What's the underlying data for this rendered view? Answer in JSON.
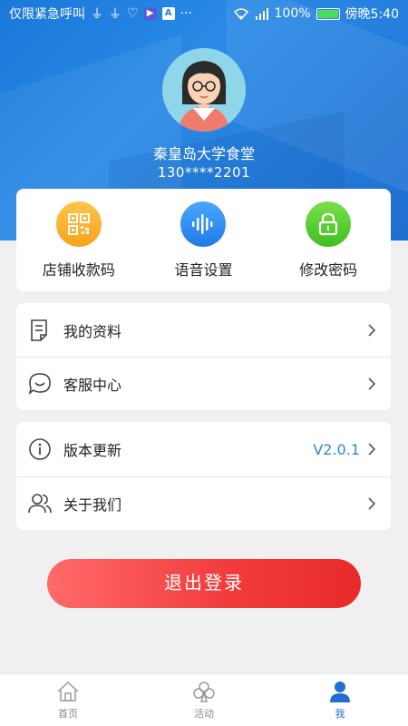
{
  "status_bar": {
    "carrier_text": "仅限紧急呼叫",
    "battery_percent": "100%",
    "time": "傍晚5:40"
  },
  "profile": {
    "name": "秦皇岛大学食堂",
    "phone": "130****2201"
  },
  "quick_actions": [
    {
      "label": "店铺收款码",
      "icon": "qr-code-icon",
      "color": "#f7a21c"
    },
    {
      "label": "语音设置",
      "icon": "sound-wave-icon",
      "color": "#1f7ae6"
    },
    {
      "label": "修改密码",
      "icon": "lock-icon",
      "color": "#3fbf22"
    }
  ],
  "menu_group_1": [
    {
      "label": "我的资料",
      "icon": "document-icon"
    },
    {
      "label": "客服中心",
      "icon": "chat-smile-icon"
    }
  ],
  "menu_group_2": [
    {
      "label": "版本更新",
      "icon": "info-icon",
      "value": "V2.0.1"
    },
    {
      "label": "关于我们",
      "icon": "users-icon"
    }
  ],
  "logout_label": "退出登录",
  "tabbar": [
    {
      "label": "首页",
      "icon": "home-icon",
      "active": false
    },
    {
      "label": "活动",
      "icon": "club-icon",
      "active": false
    },
    {
      "label": "我",
      "icon": "person-icon",
      "active": true
    }
  ],
  "colors": {
    "accent": "#1f6fd0",
    "logout": "#f13a3a",
    "version": "#2f86d8"
  }
}
